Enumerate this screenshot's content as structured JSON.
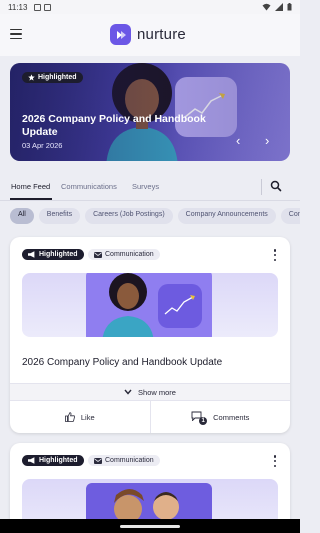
{
  "status_bar": {
    "time": "11:13"
  },
  "app_bar": {
    "brand_name": "nurture"
  },
  "hero": {
    "badge_label": "Highlighted",
    "title": "2026 Company Policy and Handbook Update",
    "date": "03 Apr 2026",
    "prev_label": "‹",
    "next_label": "›"
  },
  "tabs": [
    {
      "label": "Home Feed",
      "active": true
    },
    {
      "label": "Communications",
      "active": false
    },
    {
      "label": "Surveys",
      "active": false
    }
  ],
  "chips": [
    {
      "label": "All",
      "active": true
    },
    {
      "label": "Benefits",
      "active": false
    },
    {
      "label": "Careers (Job Postings)",
      "active": false
    },
    {
      "label": "Company Announcements",
      "active": false
    },
    {
      "label": "Com",
      "active": false
    }
  ],
  "cards": [
    {
      "badge_label": "Highlighted",
      "type_label": "Communication",
      "title": "2026 Company Policy and Handbook Update",
      "show_more_label": "Show more",
      "like_label": "Like",
      "comments_label": "Comments",
      "comments_count": "1"
    },
    {
      "badge_label": "Highlighted",
      "type_label": "Communication"
    }
  ],
  "colors": {
    "brand": "#6b57e6",
    "hero_start": "#2b2a75",
    "hero_end": "#9b8ff0",
    "badge_dark": "#1d1d2e"
  }
}
